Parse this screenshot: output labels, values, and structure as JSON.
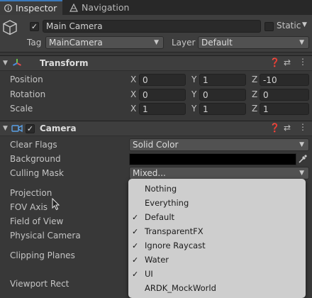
{
  "tabs": [
    {
      "label": "Inspector"
    },
    {
      "label": "Navigation"
    }
  ],
  "header": {
    "object_name": "Main Camera",
    "static_label": "Static",
    "tag_label": "Tag",
    "tag_value": "MainCamera",
    "layer_label": "Layer",
    "layer_value": "Default"
  },
  "transform": {
    "title": "Transform",
    "rows": [
      {
        "label": "Position",
        "x": "0",
        "y": "1",
        "z": "-10"
      },
      {
        "label": "Rotation",
        "x": "0",
        "y": "0",
        "z": "0"
      },
      {
        "label": "Scale",
        "x": "1",
        "y": "1",
        "z": "1"
      }
    ],
    "axis_labels": [
      "X",
      "Y",
      "Z"
    ]
  },
  "camera": {
    "title": "Camera",
    "clear_flags_label": "Clear Flags",
    "clear_flags_value": "Solid Color",
    "background_label": "Background",
    "background_color": "#000000",
    "culling_mask_label": "Culling Mask",
    "culling_mask_value": "Mixed...",
    "projection_label": "Projection",
    "fov_axis_label": "FOV Axis",
    "field_of_view_label": "Field of View",
    "physical_camera_label": "Physical Camera",
    "clipping_planes_label": "Clipping Planes",
    "viewport_rect_label": "Viewport Rect"
  },
  "culling_mask_popup": {
    "options": [
      {
        "label": "Nothing",
        "checked": false
      },
      {
        "label": "Everything",
        "checked": false
      },
      {
        "label": "Default",
        "checked": true
      },
      {
        "label": "TransparentFX",
        "checked": true
      },
      {
        "label": "Ignore Raycast",
        "checked": true
      },
      {
        "label": "Water",
        "checked": true
      },
      {
        "label": "UI",
        "checked": true
      },
      {
        "label": "ARDK_MockWorld",
        "checked": false
      }
    ]
  },
  "colors": {
    "accent": "#3a79bb",
    "panel": "#383838",
    "popup": "#cecece"
  }
}
